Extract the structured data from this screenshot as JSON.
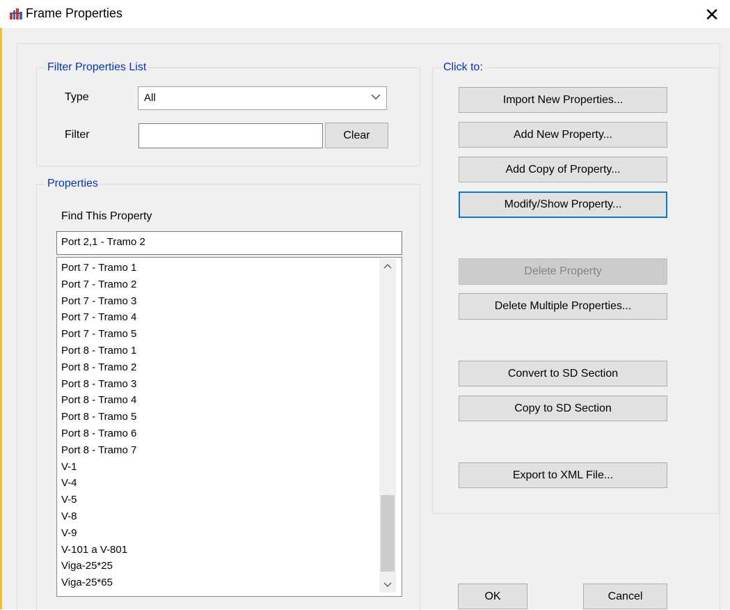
{
  "window": {
    "title": "Frame Properties",
    "close_glyph": "✕"
  },
  "filter": {
    "legend": "Filter Properties List",
    "type_label": "Type",
    "type_value": "All",
    "filter_label": "Filter",
    "filter_value": "",
    "clear_label": "Clear"
  },
  "properties": {
    "legend": "Properties",
    "find_label": "Find This Property",
    "find_value": "Port 2,1 - Tramo 2",
    "items": [
      "Port 7 - Tramo 1",
      "Port 7 - Tramo 2",
      "Port 7 - Tramo 3",
      "Port 7 - Tramo 4",
      "Port 7 - Tramo 5",
      "Port 8 - Tramo 1",
      "Port 8 - Tramo 2",
      "Port 8 - Tramo 3",
      "Port 8 - Tramo 4",
      "Port 8 - Tramo 5",
      "Port 8 - Tramo 6",
      "Port 8 - Tramo 7",
      "V-1",
      "V-4",
      "V-5",
      "V-8",
      "V-9",
      "V-101 a V-801",
      "Viga-25*25",
      "Viga-25*65"
    ],
    "scroll_up_glyph": "⌃",
    "scroll_down_glyph": "⌄"
  },
  "click_to": {
    "legend": "Click to:",
    "import_label": "Import New Properties...",
    "add_new_label": "Add New Property...",
    "add_copy_label": "Add Copy of Property...",
    "modify_label": "Modify/Show Property...",
    "delete_label": "Delete Property",
    "delete_multiple_label": "Delete Multiple Properties...",
    "convert_label": "Convert to SD Section",
    "copy_sd_label": "Copy to SD Section",
    "export_label": "Export to XML File..."
  },
  "footer": {
    "ok_label": "OK",
    "cancel_label": "Cancel"
  },
  "colors": {
    "accent": "#0078d7",
    "legend_text": "#0033bb",
    "window_border": "#f2c11d"
  }
}
